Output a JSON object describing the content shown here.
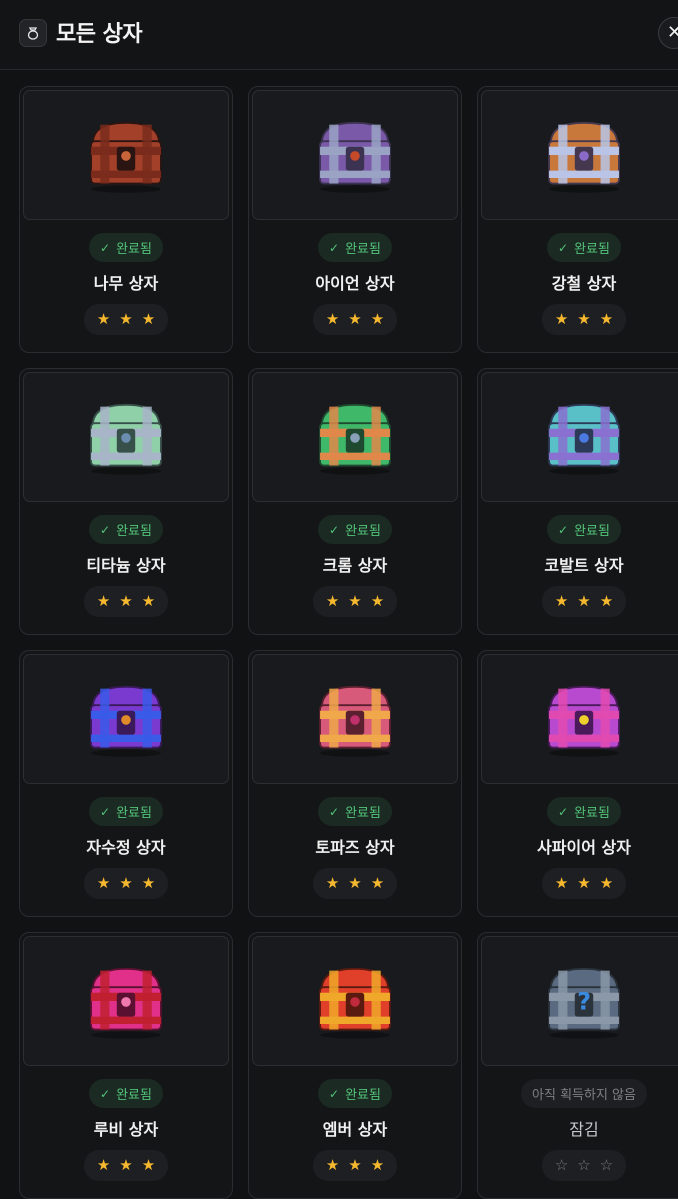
{
  "header": {
    "title": "모든 상자",
    "icon": "bag-icon",
    "close_icon": "close-icon"
  },
  "status_completed": "완료됨",
  "status_locked": "아직 획득하지 않음",
  "colors": {
    "completed_text": "#52c47a",
    "star": "#f5b82e",
    "background": "#111214"
  },
  "chests": [
    {
      "name": "나무 상자",
      "state": "completed",
      "stars": 3,
      "palette": [
        "#a3402a",
        "#7a2b1c",
        "#c8643a",
        "#2a1512"
      ]
    },
    {
      "name": "아이언 상자",
      "state": "completed",
      "stars": 3,
      "palette": [
        "#7a5aa8",
        "#9aa3c4",
        "#c44a2a",
        "#3c3252"
      ]
    },
    {
      "name": "강철 상자",
      "state": "completed",
      "stars": 3,
      "palette": [
        "#c9783c",
        "#b9c4e6",
        "#8a6ac8",
        "#45384e"
      ]
    },
    {
      "name": "티타늄 상자",
      "state": "completed",
      "stars": 3,
      "palette": [
        "#8fd0a8",
        "#a8b4c8",
        "#6a8db0",
        "#38504a"
      ]
    },
    {
      "name": "크롬 상자",
      "state": "completed",
      "stars": 3,
      "palette": [
        "#3fb86a",
        "#e0874a",
        "#8aa0b8",
        "#1f4a30"
      ]
    },
    {
      "name": "코발트 상자",
      "state": "completed",
      "stars": 3,
      "palette": [
        "#5ac0c8",
        "#8a70d0",
        "#4a7ae0",
        "#2c3a58"
      ]
    },
    {
      "name": "자수정 상자",
      "state": "completed",
      "stars": 3,
      "palette": [
        "#7a3ad0",
        "#3a5ae8",
        "#e08a2a",
        "#3a1a5a"
      ]
    },
    {
      "name": "토파즈 상자",
      "state": "completed",
      "stars": 3,
      "palette": [
        "#d85a7a",
        "#f0a84a",
        "#c0306a",
        "#5a2030"
      ]
    },
    {
      "name": "사파이어 상자",
      "state": "completed",
      "stars": 3,
      "palette": [
        "#b84ad0",
        "#e04ab0",
        "#f0d02a",
        "#4a1a5a"
      ]
    },
    {
      "name": "루비 상자",
      "state": "completed",
      "stars": 3,
      "palette": [
        "#e0308a",
        "#c02030",
        "#f07ab0",
        "#5a1030"
      ]
    },
    {
      "name": "엠버 상자",
      "state": "completed",
      "stars": 3,
      "palette": [
        "#e0402a",
        "#f0a82a",
        "#c02a3a",
        "#5a1a10"
      ]
    },
    {
      "name": "잠김",
      "state": "locked",
      "stars": 0,
      "palette": [
        "#5a6a80",
        "#8a98a8",
        "#3a8ae0",
        "#2a323c"
      ]
    }
  ]
}
